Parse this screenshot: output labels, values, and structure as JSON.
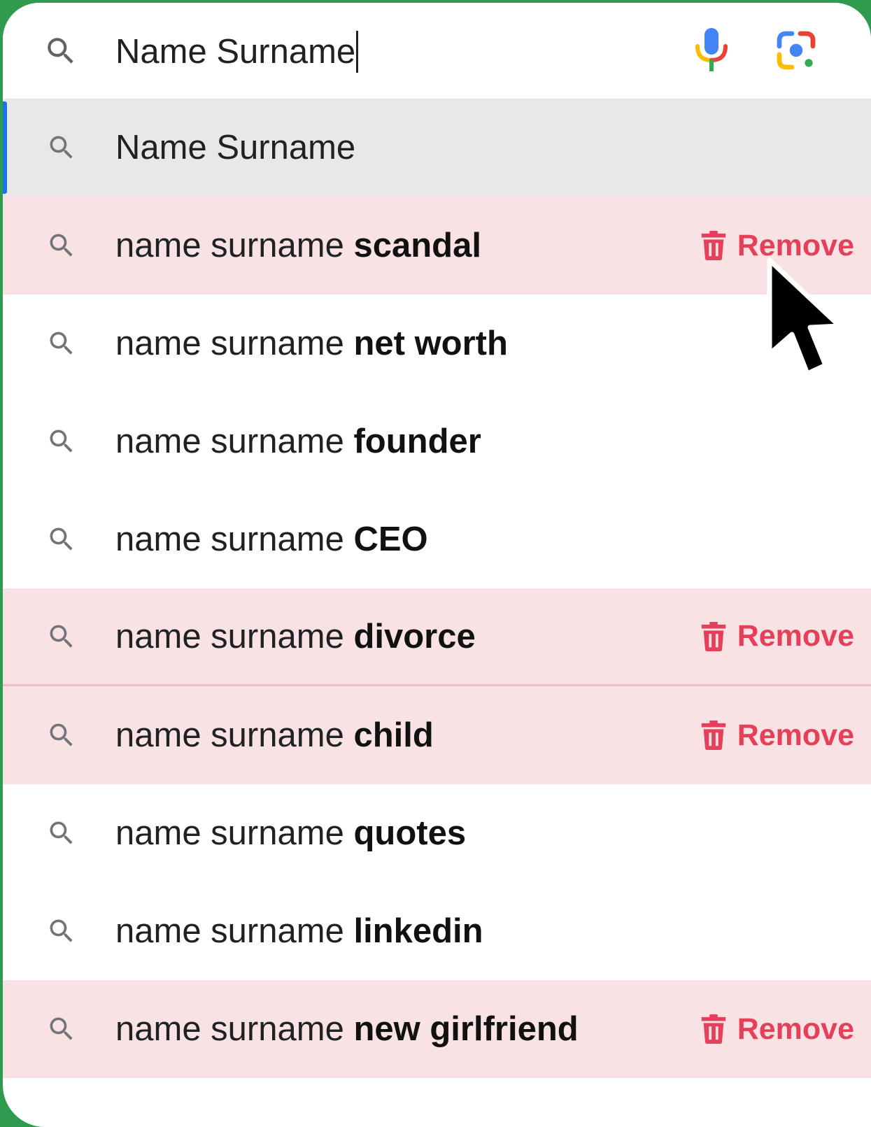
{
  "search": {
    "query": "Name Surname",
    "lead_icon": "search-icon",
    "voice_icon": "microphone-icon",
    "lens_icon": "lens-camera-icon"
  },
  "suggestions": [
    {
      "prefix": "Name Surname",
      "bold": "",
      "remove": "",
      "style": "selected"
    },
    {
      "prefix": "name surname ",
      "bold": "scandal",
      "remove": "Remove",
      "style": "flagged"
    },
    {
      "prefix": "name surname ",
      "bold": "net worth",
      "remove": "",
      "style": "plain"
    },
    {
      "prefix": "name surname ",
      "bold": "founder",
      "remove": "",
      "style": "plain"
    },
    {
      "prefix": "name surname ",
      "bold": "CEO",
      "remove": "",
      "style": "plain"
    },
    {
      "prefix": "name surname ",
      "bold": "divorce",
      "remove": "Remove",
      "style": "flagged"
    },
    {
      "prefix": "name surname ",
      "bold": "child",
      "remove": "Remove",
      "style": "flagged"
    },
    {
      "prefix": "name surname ",
      "bold": "quotes",
      "remove": "",
      "style": "plain"
    },
    {
      "prefix": "name surname ",
      "bold": "linkedin",
      "remove": "",
      "style": "plain"
    },
    {
      "prefix": "name surname ",
      "bold": "new girlfriend",
      "remove": "Remove",
      "style": "flagged"
    }
  ],
  "colors": {
    "accent_remove": "#e5405a",
    "flagged_row": "#f9e2e4",
    "selected_row": "#e8e8e8",
    "selected_marker": "#1a73e8",
    "frame": "#2e9b4e"
  },
  "cursor_icon": "arrow-pointer-icon"
}
